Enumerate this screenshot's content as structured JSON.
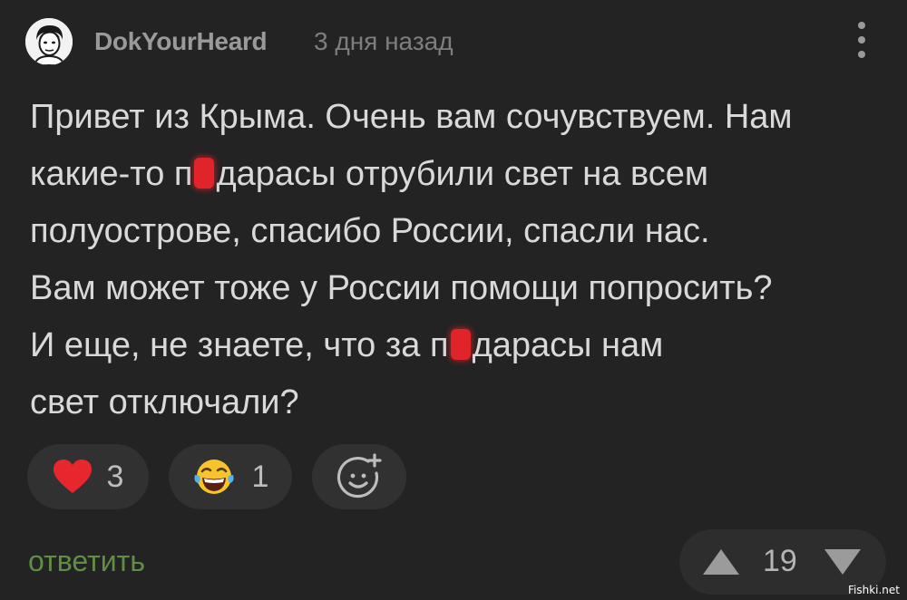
{
  "comment_header": {
    "username": "DokYourHeard",
    "timestamp": "3 дня назад"
  },
  "comment": {
    "lines": [
      {
        "text": "Привет из Крыма. Очень вам сочувствуем. Нам"
      },
      {
        "before": "какие-то п",
        "after": "дарасы отрубили свет на всем"
      },
      {
        "text": "полуострове, спасибо России, спасли нас."
      },
      {
        "text": "Вам может тоже у России помощи попросить?"
      },
      {
        "before": "И еще, не знаете, что за п",
        "after": "дарасы нам"
      },
      {
        "text": "свет отключали?"
      }
    ]
  },
  "reactions": {
    "heart": {
      "icon": "heart-icon",
      "count": "3",
      "color": "#e8262e"
    },
    "laugh": {
      "icon": "laughing-emoji-icon",
      "count": "1"
    },
    "add": {
      "icon": "add-reaction-icon"
    }
  },
  "actions": {
    "reply_label": "ответить",
    "reply_color": "#5e8f43"
  },
  "votes": {
    "score": "19",
    "up_icon": "upvote-arrow-icon",
    "down_icon": "downvote-arrow-icon"
  },
  "watermark": "Fishki.net",
  "colors": {
    "background": "#232323",
    "pill": "#313131",
    "text": "#d9d9d9",
    "censor": "#e0242a"
  }
}
